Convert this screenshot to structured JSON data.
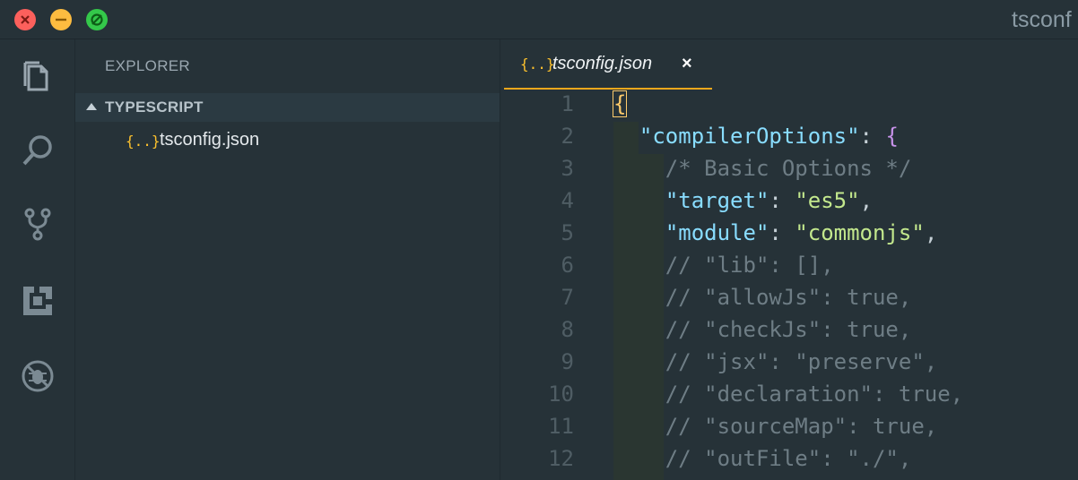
{
  "window": {
    "title": "tsconf"
  },
  "activity_bar": {
    "icons": [
      "files-icon",
      "search-icon",
      "source-control-icon",
      "extensions-icon",
      "debug-icon"
    ]
  },
  "sidebar": {
    "title": "EXPLORER",
    "section": "TYPESCRIPT",
    "files": [
      {
        "icon_glyph": "{..}",
        "name": "tsconfig.json"
      }
    ]
  },
  "editor": {
    "tab": {
      "icon_glyph": "{..}",
      "label": "tsconfig.json",
      "close": "×"
    },
    "lines": [
      {
        "number": "1",
        "text": "{"
      },
      {
        "number": "2",
        "text": "  \"compilerOptions\": {"
      },
      {
        "number": "3",
        "text": "    /* Basic Options */"
      },
      {
        "number": "4",
        "text": "    \"target\": \"es5\","
      },
      {
        "number": "5",
        "text": "    \"module\": \"commonjs\","
      },
      {
        "number": "6",
        "text": "    // \"lib\": [],"
      },
      {
        "number": "7",
        "text": "    // \"allowJs\": true,"
      },
      {
        "number": "8",
        "text": "    // \"checkJs\": true,"
      },
      {
        "number": "9",
        "text": "    // \"jsx\": \"preserve\","
      },
      {
        "number": "10",
        "text": "    // \"declaration\": true,"
      },
      {
        "number": "11",
        "text": "    // \"sourceMap\": true,"
      },
      {
        "number": "12",
        "text": "    // \"outFile\": \"./\","
      }
    ]
  },
  "colors": {
    "background": "#263238",
    "accent": "#f0a81c",
    "key": "#89ddff",
    "string": "#c3e88d",
    "comment": "#6e7d85",
    "brace": "#ffcb6b"
  }
}
